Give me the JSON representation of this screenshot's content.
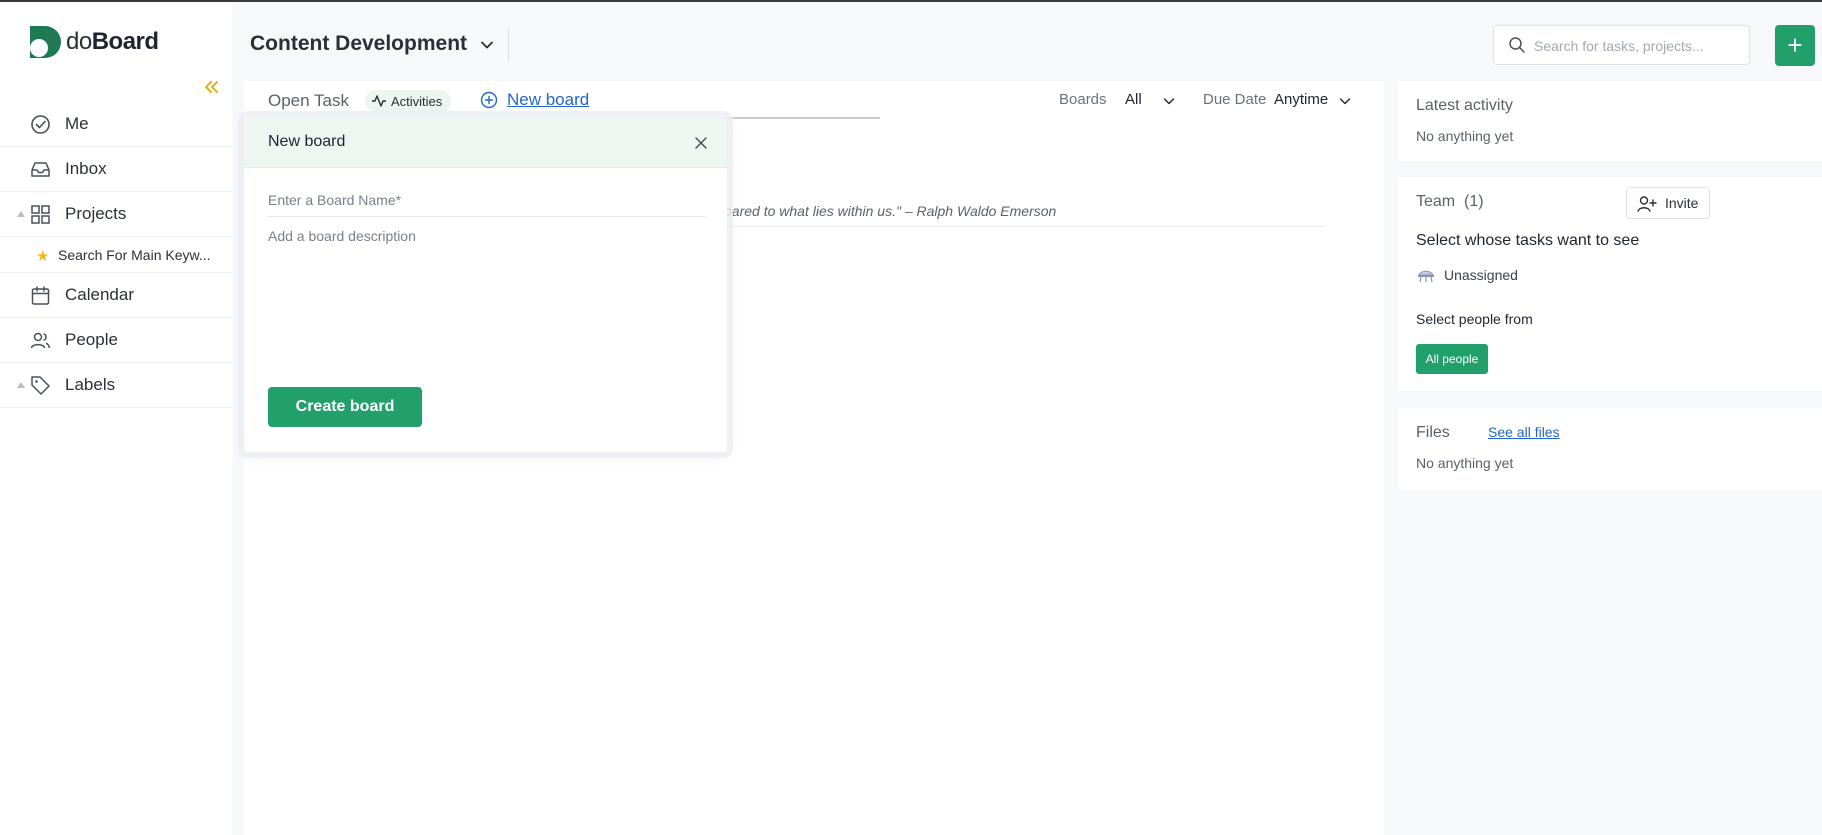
{
  "app": {
    "logo_prefix": "do",
    "logo_suffix": "Board"
  },
  "sidebar": {
    "items": [
      {
        "label": "Me",
        "icon": "check-circle-icon"
      },
      {
        "label": "Inbox",
        "icon": "inbox-icon"
      },
      {
        "label": "Projects",
        "icon": "grid-icon"
      },
      {
        "label": "Search For Main Keyw...",
        "icon": "star-icon"
      },
      {
        "label": "Calendar",
        "icon": "calendar-icon"
      },
      {
        "label": "People",
        "icon": "people-icon"
      },
      {
        "label": "Labels",
        "icon": "tag-icon"
      }
    ]
  },
  "header": {
    "project_title": "Content Development",
    "search_placeholder": "Search for tasks, projects...",
    "add_label": "+"
  },
  "toolbar": {
    "open_task": "Open Task",
    "activities": "Activities",
    "new_board": "New board",
    "boards_label": "Boards",
    "boards_value": "All",
    "due_label": "Due Date",
    "due_value": "Anytime"
  },
  "quote": "pared to what lies within us.\" – Ralph Waldo Emerson",
  "modal": {
    "title": "New board",
    "name_placeholder": "Enter a Board Name*",
    "desc_placeholder": "Add a board description",
    "create_label": "Create board"
  },
  "latest_activity": {
    "title": "Latest activity",
    "empty": "No anything yet"
  },
  "team": {
    "title": "Team",
    "count": "(1)",
    "invite_label": "Invite",
    "subtitle": "Select whose tasks want to see",
    "unassigned": "Unassigned",
    "select_from": "Select people from",
    "all_people": "All people"
  },
  "files": {
    "title": "Files",
    "see_all": "See all files",
    "empty": "No anything yet"
  },
  "colors": {
    "accent": "#22a06b",
    "link": "#2367c9",
    "collapse": "#e0b21c"
  }
}
